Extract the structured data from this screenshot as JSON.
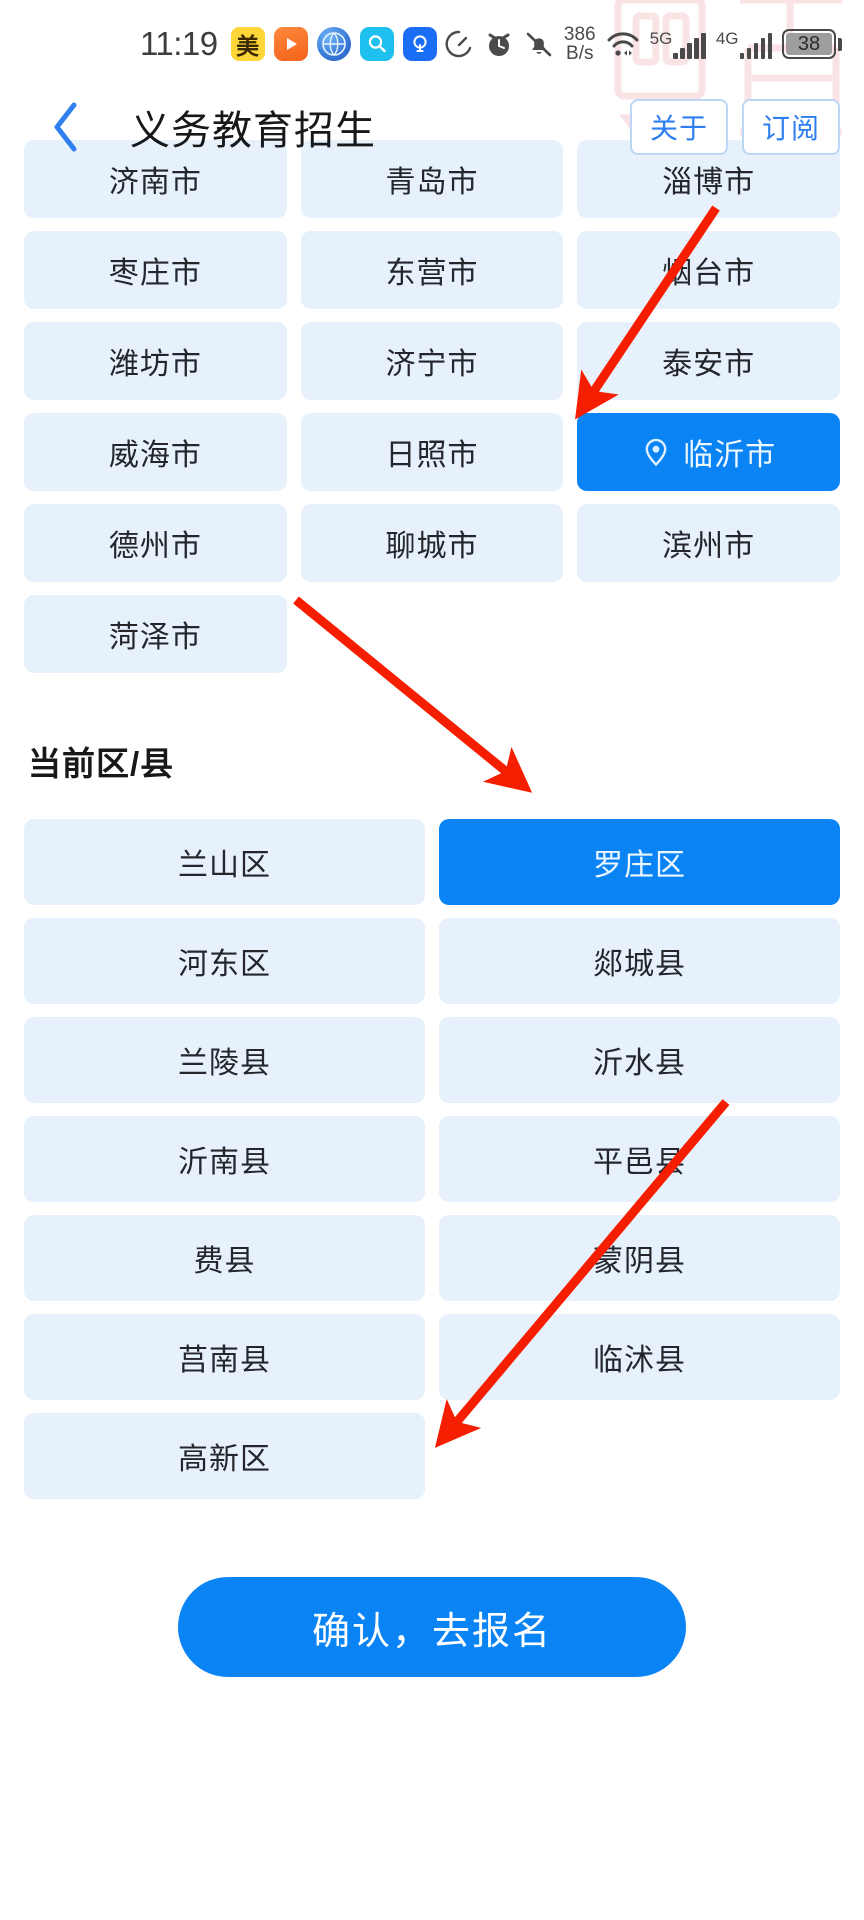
{
  "status_bar": {
    "time": "11:19",
    "app_icons": [
      {
        "name": "meituan-app-icon",
        "glyph": "美"
      },
      {
        "name": "video-play-app-icon",
        "glyph": "▶"
      },
      {
        "name": "browser-globe-app-icon",
        "glyph": "◍"
      },
      {
        "name": "search-app-icon",
        "glyph": "🔍"
      },
      {
        "name": "idea-bulb-app-icon",
        "glyph": "♀"
      }
    ],
    "right_icons": [
      {
        "name": "speed-meter-icon"
      },
      {
        "name": "alarm-clock-icon"
      },
      {
        "name": "bell-muted-icon"
      },
      {
        "name": "wifi-icon"
      }
    ],
    "net_rate": "386",
    "net_rate_unit": "B/s",
    "sim1_label": "5G",
    "sim2_label": "4G",
    "battery_level": "38"
  },
  "header": {
    "back_icon": "chevron-left-icon",
    "title": "义务教育招生",
    "about_label": "关于",
    "subscribe_label": "订阅"
  },
  "cities": {
    "selected": "临沂市",
    "items": [
      "济南市",
      "青岛市",
      "淄博市",
      "枣庄市",
      "东营市",
      "烟台市",
      "潍坊市",
      "济宁市",
      "泰安市",
      "威海市",
      "日照市",
      "临沂市",
      "德州市",
      "聊城市",
      "滨州市",
      "菏泽市"
    ]
  },
  "districts": {
    "section_title": "当前区/县",
    "selected": "罗庄区",
    "items": [
      "兰山区",
      "罗庄区",
      "河东区",
      "郯城县",
      "兰陵县",
      "沂水县",
      "沂南县",
      "平邑县",
      "费县",
      "蒙阴县",
      "莒南县",
      "临沭县",
      "高新区"
    ]
  },
  "footer": {
    "confirm_label": "确认，去报名"
  },
  "colors": {
    "accent": "#0a84f5",
    "chip_bg": "#e6f1fc",
    "chip_text": "#24262b",
    "annotation": "#f61e00",
    "header_btn_border": "#bcd6f5"
  },
  "annotations": [
    {
      "name": "arrow-to-selected-city",
      "target": "临沂市"
    },
    {
      "name": "arrow-to-selected-district",
      "target": "罗庄区"
    },
    {
      "name": "arrow-to-confirm-button",
      "target": "确认，去报名"
    }
  ]
}
